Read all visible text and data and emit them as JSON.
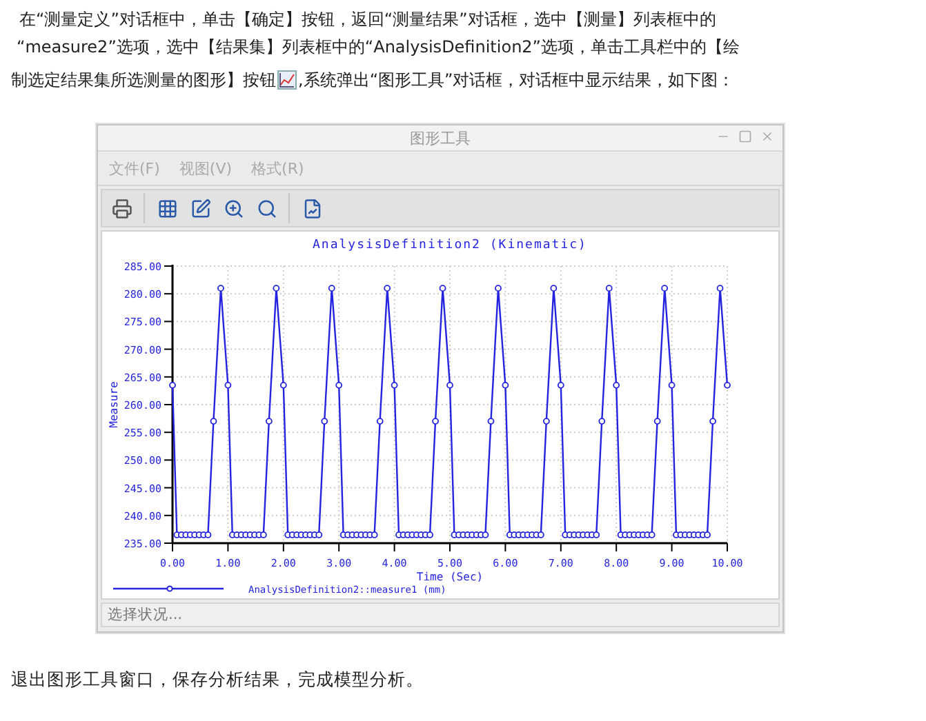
{
  "intro": {
    "lines": [
      "在“测量定义”对话框中，单击【确定】按钮，返回“测量结果”对话框，选中【测量】列表框中的",
      "“measure2”选项，选中【结果集】列表框中的“AnalysisDefinition2”选项，单击工具栏中的【绘"
    ],
    "text_before_icon": "制选定结果集所选测量的图形】按钮",
    "text_after_icon": ",系统弹出“图形工具”对话框，对话框中显示结果，如下图："
  },
  "window": {
    "title": "图形工具",
    "menu": [
      "文件(F)",
      "视图(V)",
      "格式(R)"
    ],
    "chart_data": {
      "type": "line",
      "title": "AnalysisDefinition2 (Kinematic)",
      "xlabel": "Time (Sec)",
      "ylabel": "Measure",
      "x": [
        0,
        0.08,
        0.16,
        0.24,
        0.32,
        0.4,
        0.48,
        0.56,
        0.64,
        0.74,
        0.87,
        1,
        1.08,
        1.16,
        1.24,
        1.32,
        1.4,
        1.48,
        1.56,
        1.64,
        1.74,
        1.87,
        2,
        2.08,
        2.16,
        2.24,
        2.32,
        2.4,
        2.48,
        2.56,
        2.64,
        2.74,
        2.87,
        3,
        3.08,
        3.16,
        3.24,
        3.32,
        3.4,
        3.48,
        3.56,
        3.64,
        3.74,
        3.87,
        4,
        4.08,
        4.16,
        4.24,
        4.32,
        4.4,
        4.48,
        4.56,
        4.64,
        4.74,
        4.87,
        5,
        5.08,
        5.16,
        5.24,
        5.32,
        5.4,
        5.48,
        5.56,
        5.64,
        5.74,
        5.87,
        6,
        6.08,
        6.16,
        6.24,
        6.32,
        6.4,
        6.48,
        6.56,
        6.64,
        6.74,
        6.87,
        7,
        7.08,
        7.16,
        7.24,
        7.32,
        7.4,
        7.48,
        7.56,
        7.64,
        7.74,
        7.87,
        8,
        8.08,
        8.16,
        8.24,
        8.32,
        8.4,
        8.48,
        8.56,
        8.64,
        8.74,
        8.87,
        9,
        9.08,
        9.16,
        9.24,
        9.32,
        9.4,
        9.48,
        9.56,
        9.64,
        9.74,
        9.87,
        10
      ],
      "series": [
        {
          "name": "AnalysisDefinition2::measure1 (mm)",
          "color": "#2424e0",
          "marker": "circle",
          "values": [
            263.5,
            236.5,
            236.5,
            236.5,
            236.5,
            236.5,
            236.5,
            236.5,
            236.5,
            257,
            281,
            263.5,
            236.5,
            236.5,
            236.5,
            236.5,
            236.5,
            236.5,
            236.5,
            236.5,
            257,
            281,
            263.5,
            236.5,
            236.5,
            236.5,
            236.5,
            236.5,
            236.5,
            236.5,
            236.5,
            257,
            281,
            263.5,
            236.5,
            236.5,
            236.5,
            236.5,
            236.5,
            236.5,
            236.5,
            236.5,
            257,
            281,
            263.5,
            236.5,
            236.5,
            236.5,
            236.5,
            236.5,
            236.5,
            236.5,
            236.5,
            257,
            281,
            263.5,
            236.5,
            236.5,
            236.5,
            236.5,
            236.5,
            236.5,
            236.5,
            236.5,
            257,
            281,
            263.5,
            236.5,
            236.5,
            236.5,
            236.5,
            236.5,
            236.5,
            236.5,
            236.5,
            257,
            281,
            263.5,
            236.5,
            236.5,
            236.5,
            236.5,
            236.5,
            236.5,
            236.5,
            236.5,
            257,
            281,
            263.5,
            236.5,
            236.5,
            236.5,
            236.5,
            236.5,
            236.5,
            236.5,
            236.5,
            257,
            281,
            263.5,
            236.5,
            236.5,
            236.5,
            236.5,
            236.5,
            236.5,
            236.5,
            236.5,
            257,
            281,
            263.5
          ]
        }
      ],
      "xlim": [
        0,
        10
      ],
      "ylim": [
        235,
        285
      ],
      "grid": true,
      "xticks": [
        {
          "value": 0,
          "label": "0.00"
        },
        {
          "value": 1,
          "label": "1.00"
        },
        {
          "value": 2,
          "label": "2.00"
        },
        {
          "value": 3,
          "label": "3.00"
        },
        {
          "value": 4,
          "label": "4.00"
        },
        {
          "value": 5,
          "label": "5.00"
        },
        {
          "value": 6,
          "label": "6.00"
        },
        {
          "value": 7,
          "label": "7.00"
        },
        {
          "value": 8,
          "label": "8.00"
        },
        {
          "value": 9,
          "label": "9.00"
        },
        {
          "value": 10,
          "label": "10.00"
        }
      ],
      "yticks": [
        {
          "value": 235,
          "label": "235.00"
        },
        {
          "value": 240,
          "label": "240.00"
        },
        {
          "value": 245,
          "label": "245.00"
        },
        {
          "value": 250,
          "label": "250.00"
        },
        {
          "value": 255,
          "label": "255.00"
        },
        {
          "value": 260,
          "label": "260.00"
        },
        {
          "value": 265,
          "label": "265.00"
        },
        {
          "value": 270,
          "label": "270.00"
        },
        {
          "value": 275,
          "label": "275.00"
        },
        {
          "value": 280,
          "label": "280.00"
        },
        {
          "value": 285,
          "label": "285.00"
        }
      ]
    },
    "status_bar": "选择状况..."
  },
  "outro": "退出图形工具窗口，保存分析结果，完成模型分析。"
}
